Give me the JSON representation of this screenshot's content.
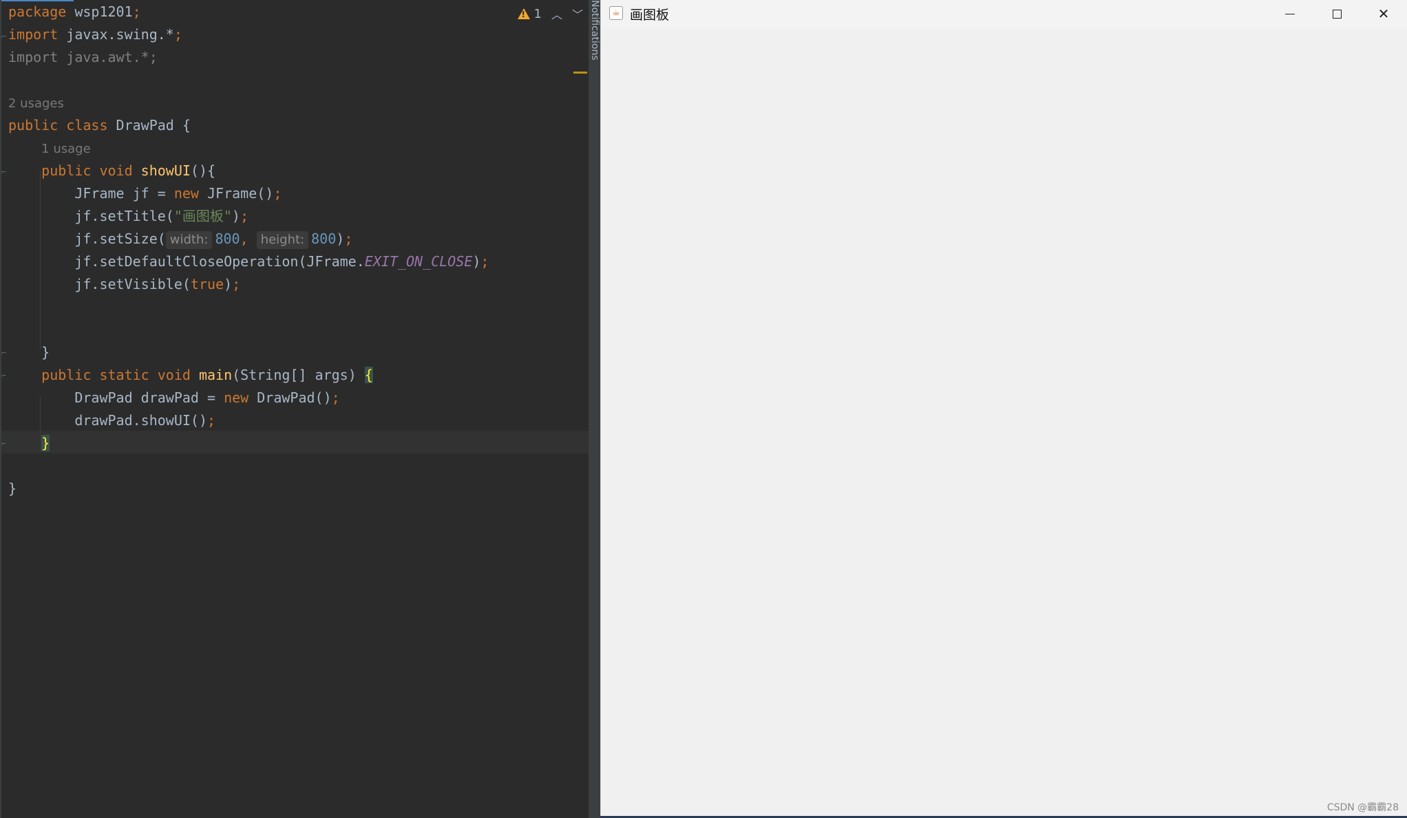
{
  "editor": {
    "inspection": {
      "warning_count": "1"
    },
    "lines": [
      {
        "html": "<span class='kw'>package</span> wsp1201<span class='kw'>;</span>"
      },
      {
        "html": "<span class='kw'>import</span> javax.swing.*<span class='kw'>;</span>"
      },
      {
        "html": "<span class='dim'>import java.awt.*;</span>"
      },
      {
        "html": ""
      },
      {
        "html": "<span class='hint'>2 usages</span>"
      },
      {
        "html": "<span class='kw'>public class</span> DrawPad {"
      },
      {
        "html": "    <span class='hint'>1 usage</span>"
      },
      {
        "html": "    <span class='kw'>public void</span> <span class='fn'>showUI</span>(){"
      },
      {
        "html": "        JFrame jf = <span class='kw'>new</span> JFrame()<span class='kw'>;</span>"
      },
      {
        "html": "        jf.setTitle(<span class='str'>\"画图板\"</span>)<span class='kw'>;</span>"
      },
      {
        "html": "        jf.setSize(<span class='param'>width:</span><span class='num'>800</span><span class='kw'>,</span> <span class='param'>height:</span><span class='num'>800</span>)<span class='kw'>;</span>"
      },
      {
        "html": "        jf.setDefaultCloseOperation(JFrame.<span class='const'>EXIT_ON_CLOSE</span>)<span class='kw'>;</span>"
      },
      {
        "html": "        jf.setVisible(<span class='kw'>true</span>)<span class='kw'>;</span>"
      },
      {
        "html": ""
      },
      {
        "html": ""
      },
      {
        "html": "    }"
      },
      {
        "html": "    <span class='kw'>public static void</span> <span class='fn'>main</span>(String[] args) <span class='brace-hl'>{</span>"
      },
      {
        "html": "        DrawPad drawPad = <span class='kw'>new</span> DrawPad()<span class='kw'>;</span>"
      },
      {
        "html": "        drawPad.showUI()<span class='kw'>;</span>"
      },
      {
        "html": "    <span class='brace-hl'>}</span>"
      },
      {
        "html": ""
      },
      {
        "html": "}"
      }
    ]
  },
  "notifications": {
    "label": "Notifications"
  },
  "window": {
    "title": "画图板",
    "minimize_label": "—",
    "close_label": "✕"
  },
  "watermark": "CSDN @霸霸28",
  "colors": {
    "keyword": "#cc7832",
    "function": "#ffc66d",
    "string": "#6a8759",
    "number": "#6897bb",
    "constant": "#9876aa",
    "editor_bg": "#2b2b2b",
    "window_bg": "#f0f0f0"
  }
}
